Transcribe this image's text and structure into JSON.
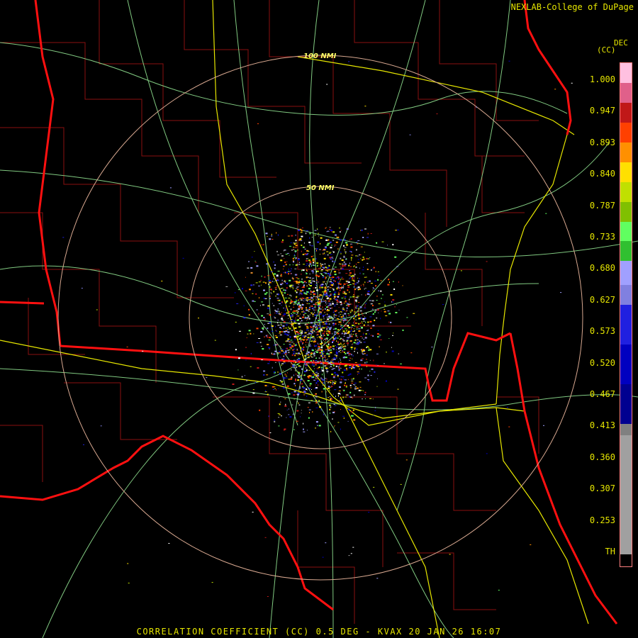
{
  "credit": "NEXLAB-College of DuPage",
  "legend": {
    "unit_lines": [
      "DEC",
      "(CC)"
    ],
    "labels": [
      "1.000",
      "0.947",
      "0.893",
      "0.840",
      "0.787",
      "0.733",
      "0.680",
      "0.627",
      "0.573",
      "0.520",
      "0.467",
      "0.413",
      "0.360",
      "0.307",
      "0.253",
      "TH"
    ],
    "colors": [
      "#ffc0e0",
      "#e0608a",
      "#c01818",
      "#ff4000",
      "#ff9000",
      "#ffe000",
      "#c0e000",
      "#80c000",
      "#60ff60",
      "#30c030",
      "#a0a0ff",
      "#8080e0",
      "#2020e0",
      "#0000c0",
      "#000090",
      "#808080",
      "#a0a0a0",
      "#000000"
    ]
  },
  "range_rings": [
    "100 NMI",
    "50 NMI"
  ],
  "footer": "CORRELATION COEFFICIENT (CC) 0.5 DEG - KVAX 20 JAN 26 16:07"
}
